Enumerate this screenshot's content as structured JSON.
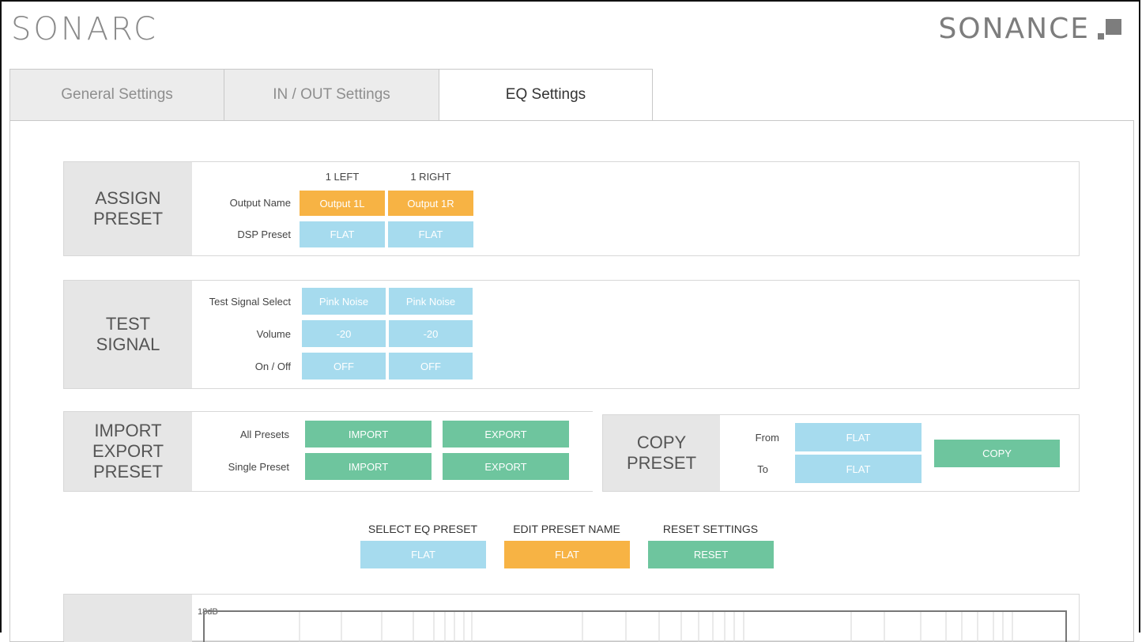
{
  "header": {
    "app_logo": "SONARC",
    "brand_logo": "SONANCE"
  },
  "tabs": [
    {
      "label": "General Settings"
    },
    {
      "label": "IN / OUT Settings"
    },
    {
      "label": "EQ Settings"
    }
  ],
  "assign_preset": {
    "title": "ASSIGN\nPRESET",
    "col_left": "1 LEFT",
    "col_right": "1 RIGHT",
    "output_name_label": "Output Name",
    "output_left": "Output 1L",
    "output_right": "Output 1R",
    "dsp_preset_label": "DSP Preset",
    "dsp_left": "FLAT",
    "dsp_right": "FLAT"
  },
  "test_signal": {
    "title": "TEST\nSIGNAL",
    "select_label": "Test Signal Select",
    "select_left": "Pink Noise",
    "select_right": "Pink Noise",
    "volume_label": "Volume",
    "volume_left": "-20",
    "volume_right": "-20",
    "onoff_label": "On / Off",
    "onoff_left": "OFF",
    "onoff_right": "OFF"
  },
  "import_export": {
    "title": "IMPORT\nEXPORT\nPRESET",
    "all_label": "All Presets",
    "single_label": "Single Preset",
    "import_label": "IMPORT",
    "export_label": "EXPORT"
  },
  "copy_preset": {
    "title": "COPY\nPRESET",
    "from_label": "From",
    "to_label": "To",
    "from_value": "FLAT",
    "to_value": "FLAT",
    "copy_label": "COPY"
  },
  "actions": {
    "select_caption": "SELECT EQ PRESET",
    "select_value": "FLAT",
    "edit_caption": "EDIT PRESET NAME",
    "edit_value": "FLAT",
    "reset_caption": "RESET SETTINGS",
    "reset_value": "RESET"
  },
  "eq_graph": {
    "top_label": "18dB"
  },
  "colors": {
    "blue": "#a6dbee",
    "orange": "#f7b344",
    "green": "#6ec59e",
    "label_bg": "#e6e6e6"
  }
}
